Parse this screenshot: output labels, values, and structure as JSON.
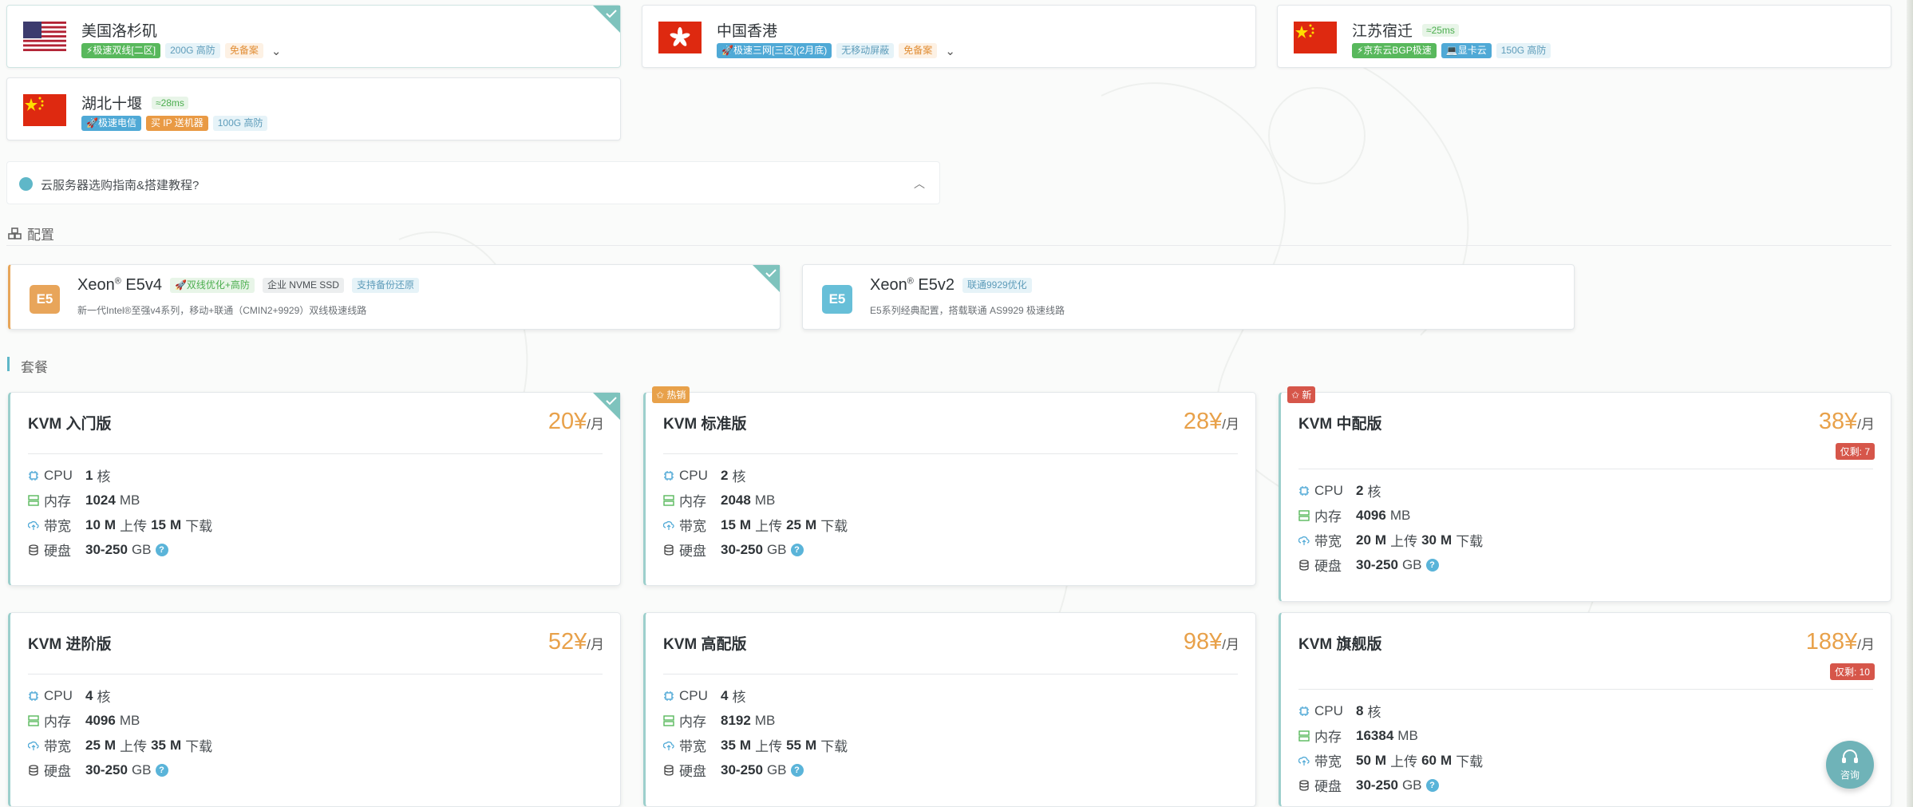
{
  "regions": [
    {
      "name": "美国洛杉矶",
      "flag": "us-flag",
      "tags": [
        {
          "text": "⚡极速双线[二区]",
          "style": "green-solid"
        },
        {
          "text": "200G 高防",
          "style": "light-blue"
        },
        {
          "text": "免备案",
          "style": "light-orange"
        }
      ],
      "has_chevron": true,
      "ping": "",
      "selected": true
    },
    {
      "name": "中国香港",
      "flag": "hk-flag",
      "tags": [
        {
          "text": "🚀极速三网[三区](2月底)",
          "style": "blue-solid"
        },
        {
          "text": "无移动屏蔽",
          "style": "light-blue"
        },
        {
          "text": "免备案",
          "style": "light-orange"
        }
      ],
      "has_chevron": true,
      "ping": "",
      "selected": false
    },
    {
      "name": "江苏宿迁",
      "flag": "cn-flag",
      "tags": [
        {
          "text": "⚡京东云BGP极速",
          "style": "green-solid"
        },
        {
          "text": "💻显卡云",
          "style": "blue-solid"
        },
        {
          "text": "150G 高防",
          "style": "light-blue"
        }
      ],
      "has_chevron": false,
      "ping": "≈25ms",
      "selected": false
    },
    {
      "name": "湖北十堰",
      "flag": "cn-flag",
      "tags": [
        {
          "text": "🚀极速电信",
          "style": "blue-solid"
        },
        {
          "text": "买 IP 送机器",
          "style": "orange-solid"
        },
        {
          "text": "100G 高防",
          "style": "light-blue"
        }
      ],
      "has_chevron": false,
      "ping": "≈28ms",
      "selected": false
    }
  ],
  "guide": {
    "text": "云服务器选购指南&搭建教程?",
    "icon": "guide-icon"
  },
  "config_section": {
    "label": "配置",
    "icon": "cubes-icon"
  },
  "cpus": [
    {
      "badge": "E5",
      "name": "Xeon",
      "reg": "®",
      "model": "E5v4",
      "tags": [
        {
          "text": "🚀双线优化+高防",
          "style": "green"
        },
        {
          "text": "企业 NVME SSD",
          "style": "gray"
        },
        {
          "text": "支持备份还原",
          "style": "blue"
        }
      ],
      "desc": "新一代Intel®至强v4系列，移动+联通（CMIN2+9929）双线极速线路",
      "selected": true,
      "color": "#e8a55a"
    },
    {
      "badge": "E5",
      "name": "Xeon",
      "reg": "®",
      "model": "E5v2",
      "tags": [
        {
          "text": "联通9929优化",
          "style": "blue"
        }
      ],
      "desc": "E5系列经典配置，搭载联通 AS9929 极速线路",
      "selected": false,
      "color": "#67bfd8"
    }
  ],
  "plan_section": {
    "label": "套餐"
  },
  "plans": [
    {
      "name": "KVM 入门版",
      "price": "20¥",
      "unit": "/月",
      "cpu": "1",
      "mem": "1024",
      "up": "10",
      "down": "15",
      "disk": "30-250",
      "stock": "",
      "badge": "",
      "selected": true
    },
    {
      "name": "KVM 标准版",
      "price": "28¥",
      "unit": "/月",
      "cpu": "2",
      "mem": "2048",
      "up": "15",
      "down": "25",
      "disk": "30-250",
      "stock": "",
      "badge": "✩ 热销",
      "selected": false
    },
    {
      "name": "KVM 中配版",
      "price": "38¥",
      "unit": "/月",
      "cpu": "2",
      "mem": "4096",
      "up": "20",
      "down": "30",
      "disk": "30-250",
      "stock": "仅剩: 7",
      "badge": "✩ 新",
      "selected": false
    },
    {
      "name": "KVM 进阶版",
      "price": "52¥",
      "unit": "/月",
      "cpu": "4",
      "mem": "4096",
      "up": "25",
      "down": "35",
      "disk": "30-250",
      "stock": "",
      "badge": "",
      "selected": false
    },
    {
      "name": "KVM 高配版",
      "price": "98¥",
      "unit": "/月",
      "cpu": "4",
      "mem": "8192",
      "up": "35",
      "down": "55",
      "disk": "30-250",
      "stock": "",
      "badge": "",
      "selected": false
    },
    {
      "name": "KVM 旗舰版",
      "price": "188¥",
      "unit": "/月",
      "cpu": "8",
      "mem": "16384",
      "up": "50",
      "down": "60",
      "disk": "30-250",
      "stock": "仅剩: 10",
      "badge": "",
      "selected": false
    }
  ],
  "spec_labels": {
    "cpu": "CPU",
    "mem": "内存",
    "bw": "带宽",
    "disk": "硬盘",
    "core": "核",
    "mb": "MB",
    "m": "M",
    "up": "上传",
    "down": "下载",
    "gb": "GB"
  },
  "consult": {
    "label": "咨询",
    "icon": "headset-icon"
  },
  "colors": {
    "accent": "#5fb7c8",
    "price": "#e8a14a",
    "stock": "#d6564a",
    "selected_corner": "#7ec3bd"
  }
}
